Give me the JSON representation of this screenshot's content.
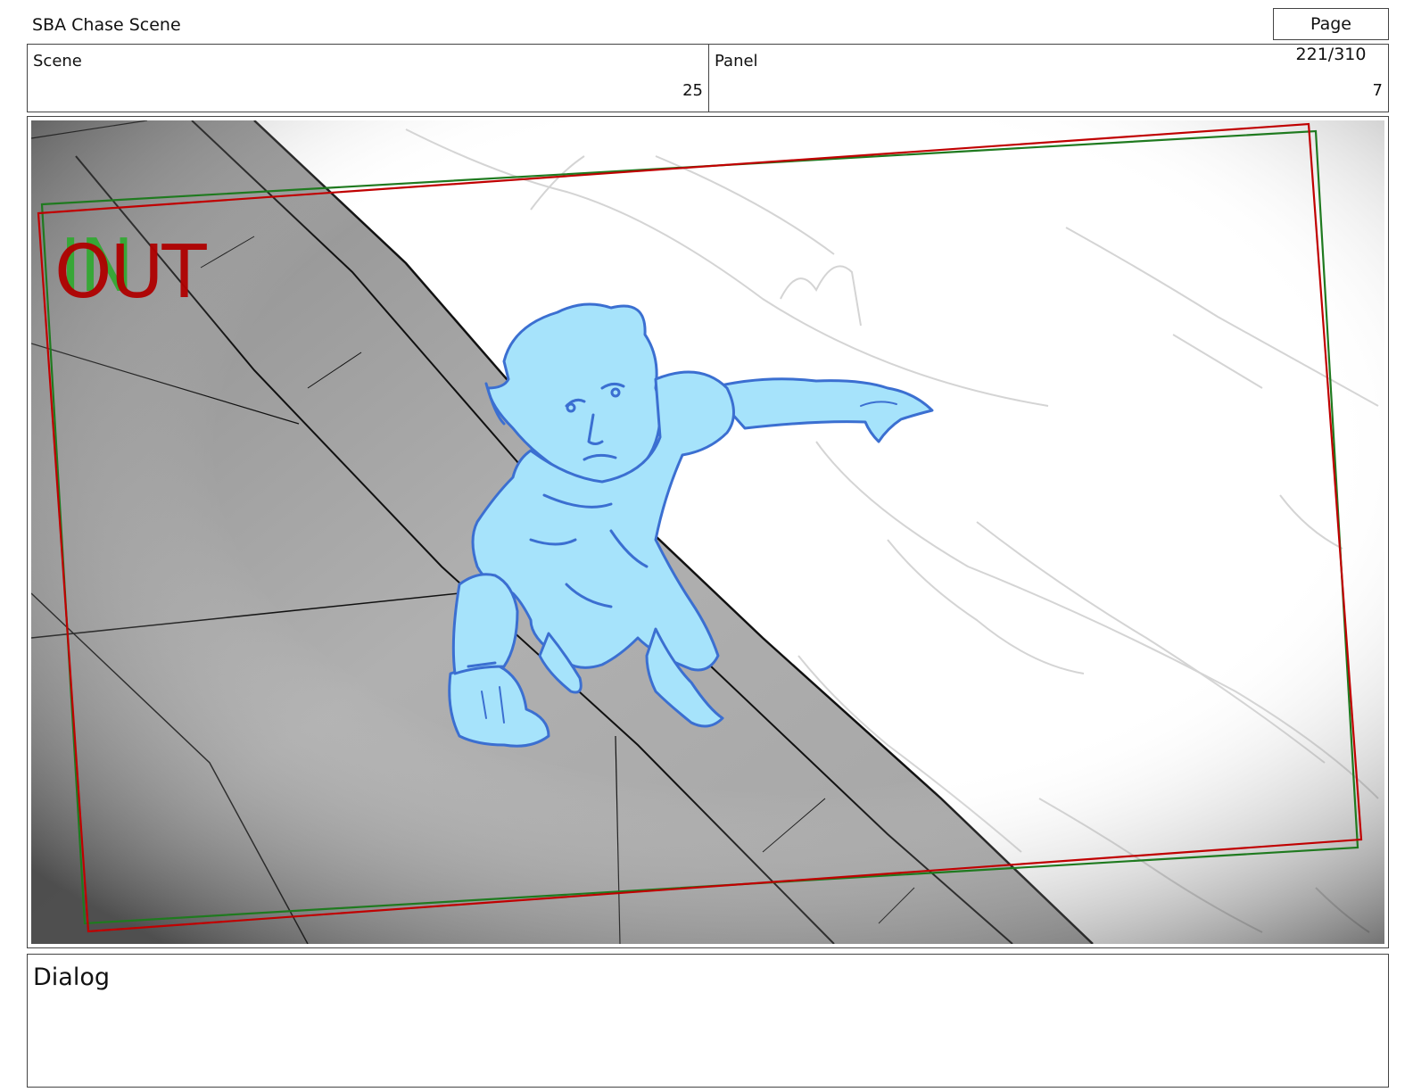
{
  "document": {
    "title": "SBA Chase Scene",
    "page": "Page 221/310"
  },
  "info": {
    "scene_label": "Scene",
    "scene_value": "25",
    "panel_label": "Panel",
    "panel_value": "7"
  },
  "frame": {
    "safe_in_label": "IN",
    "safe_out_label": "OUT",
    "colors": {
      "in_frame": "#1f7a1f",
      "out_frame": "#c00000",
      "character_fill": "#a6e3fb",
      "character_line": "#3b6fd1",
      "ledge": "#a8a8a8"
    }
  },
  "dialog": {
    "label": "Dialog"
  }
}
